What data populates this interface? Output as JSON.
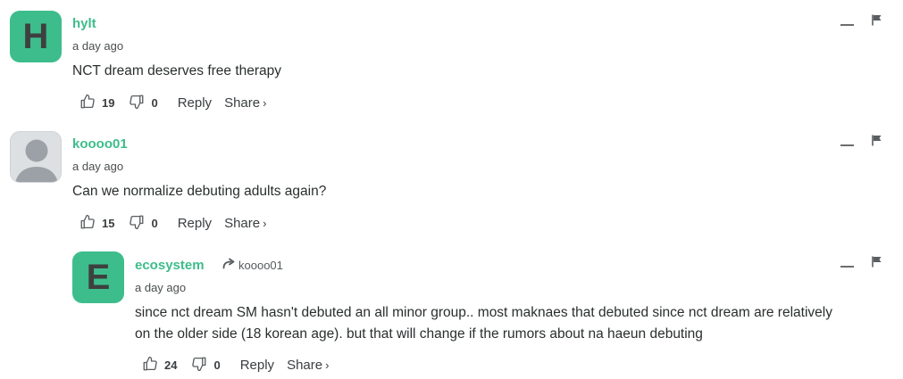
{
  "comments": [
    {
      "author": "hylt",
      "avatar_letter": "H",
      "timestamp": "a day ago",
      "text": "NCT dream deserves free therapy",
      "upvotes": "19",
      "downvotes": "0",
      "reply_label": "Reply",
      "share_label": "Share"
    },
    {
      "author": "koooo01",
      "timestamp": "a day ago",
      "text": "Can we normalize debuting adults again?",
      "upvotes": "15",
      "downvotes": "0",
      "reply_label": "Reply",
      "share_label": "Share"
    },
    {
      "author": "ecosystem",
      "avatar_letter": "E",
      "reply_to": "koooo01",
      "timestamp": "a day ago",
      "text_line1": "since nct dream SM hasn't debuted an all minor group.. most maknaes that debuted since nct dream are relatively",
      "text_line2": "on the older side (18 korean age). but that will change if the rumors about na haeun debuting",
      "upvotes": "24",
      "downvotes": "0",
      "reply_label": "Reply",
      "share_label": "Share"
    }
  ],
  "icons": {
    "share_chevron": "›",
    "upvote": "thumbs-up-icon",
    "downvote": "thumbs-down-icon",
    "minimize": "minimize-icon",
    "flag": "flag-icon",
    "reply_arrow": "arrow-right-icon"
  },
  "colors": {
    "accent": "#3dbd8c",
    "avatar_letter": "#3e4040",
    "text": "#2a2e2e"
  }
}
